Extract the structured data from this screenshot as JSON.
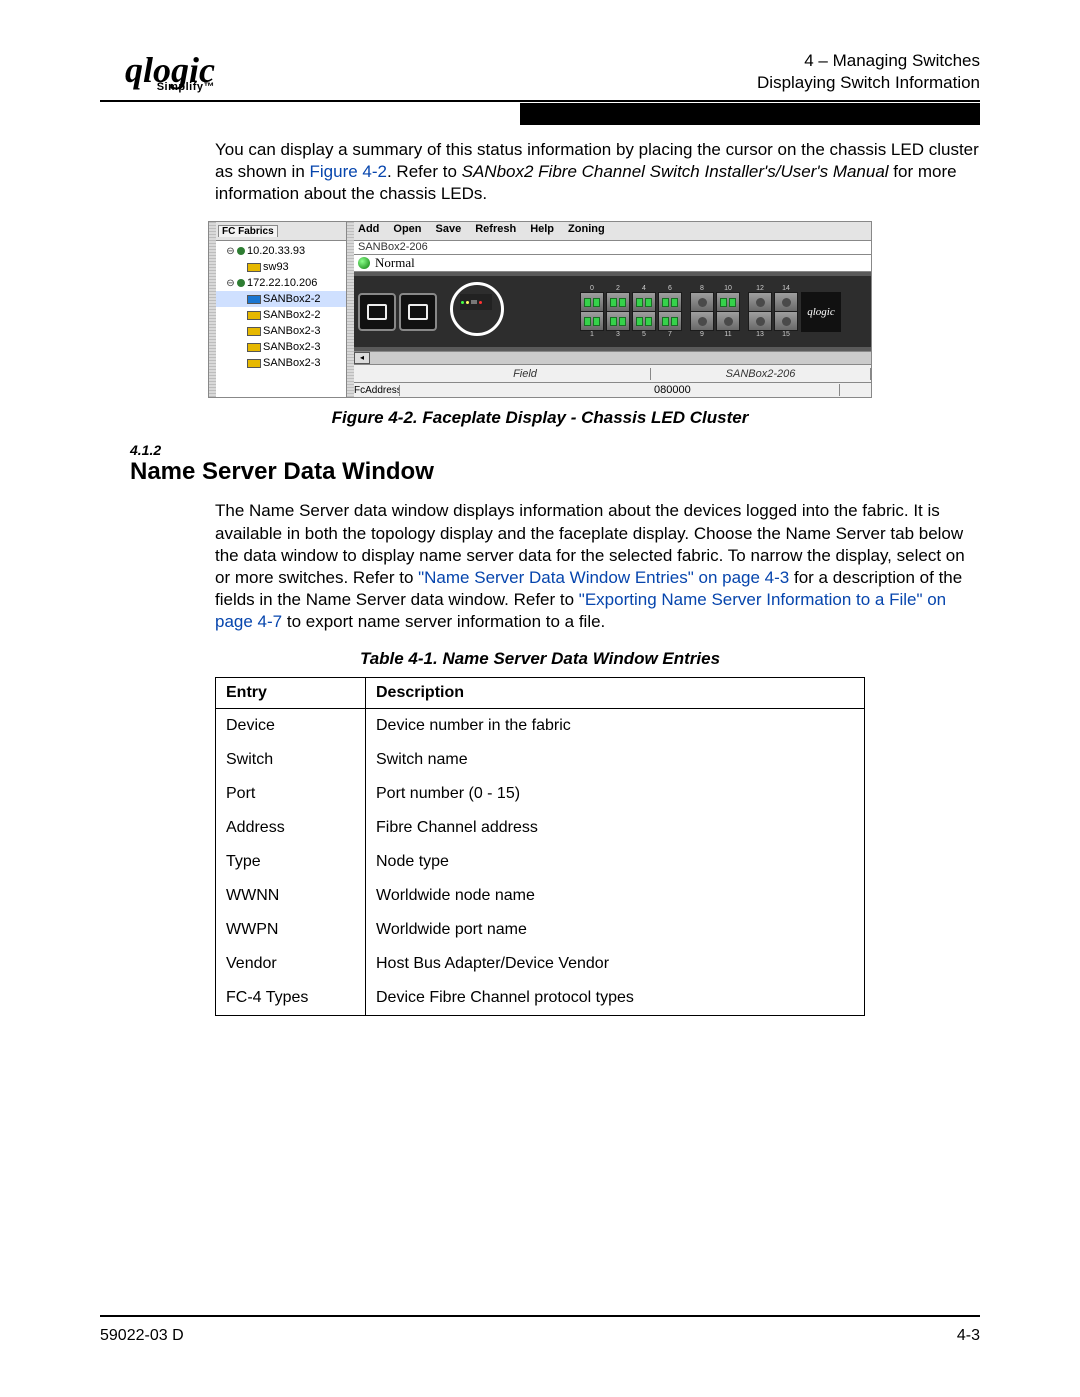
{
  "header": {
    "logo_main": "qlogic",
    "logo_sub": "Simplify™",
    "line1": "4 – Managing Switches",
    "line2": "Displaying Switch Information"
  },
  "intro": {
    "text_before_link": "You can display a summary of this status information by placing the cursor on the chassis LED cluster as shown in ",
    "fig_link": "Figure 4-2",
    "text_after_link": ". Refer to ",
    "italic": "SANbox2 Fibre Channel Switch Installer's/User's Manual",
    "text_end": " for more information about the chassis LEDs."
  },
  "screenshot": {
    "toolbar": [
      "Add",
      "Open",
      "Save",
      "Refresh",
      "Help",
      "Zoning"
    ],
    "tab_label": "FC Fabrics",
    "tree": [
      {
        "indent": 1,
        "exp": "⊖",
        "type": "dot",
        "label": "10.20.33.93"
      },
      {
        "indent": 2,
        "exp": "",
        "type": "sw",
        "label": "sw93"
      },
      {
        "indent": 1,
        "exp": "⊖",
        "type": "dot",
        "label": "172.22.10.206"
      },
      {
        "indent": 2,
        "exp": "",
        "type": "swb",
        "label": "SANBox2-2",
        "sel": true
      },
      {
        "indent": 2,
        "exp": "",
        "type": "sw",
        "label": "SANBox2-2"
      },
      {
        "indent": 2,
        "exp": "",
        "type": "sw",
        "label": "SANBox2-3"
      },
      {
        "indent": 2,
        "exp": "",
        "type": "sw",
        "label": "SANBox2-3"
      },
      {
        "indent": 2,
        "exp": "",
        "type": "sw",
        "label": "SANBox2-3"
      }
    ],
    "device_title": "SANBox2-206",
    "status": "Normal",
    "port_top": [
      "0",
      "2",
      "4",
      "6",
      "8",
      "10",
      "12",
      "14"
    ],
    "port_bot": [
      "1",
      "3",
      "5",
      "7",
      "9",
      "11",
      "13",
      "15"
    ],
    "brand": "qlogic",
    "grid_addr": "FcAddress",
    "grid_field": "Field",
    "grid_val": "080000",
    "grid_head2": "SANBox2-206"
  },
  "figure_caption": "Figure 4-2.  Faceplate Display - Chassis LED Cluster",
  "section_num": "4.1.2",
  "section_head": "Name Server Data Window",
  "para2": {
    "t1": "The Name Server data window displays information about the devices logged into the fabric. It is available in both the topology display and the faceplate display. Choose the Name Server tab below the data window to display name server data for the selected fabric. To narrow the display, select on or more switches. Refer to ",
    "link1": "\"Name Server Data Window Entries\" on page 4-3",
    "t2": " for a  description of the fields in the Name Server data window. Refer to ",
    "link2": "\"Exporting Name Server Information to a File\" on page 4-7",
    "t3": " to export name server information to a file."
  },
  "table_caption": "Table 4-1. Name Server Data Window Entries",
  "table": {
    "col1": "Entry",
    "col2": "Description",
    "rows": [
      {
        "e": "Device",
        "d": "Device number in the fabric"
      },
      {
        "e": "Switch",
        "d": "Switch name"
      },
      {
        "e": "Port",
        "d": "Port number (0 - 15)"
      },
      {
        "e": "Address",
        "d": "Fibre Channel address"
      },
      {
        "e": "Type",
        "d": "Node type"
      },
      {
        "e": "WWNN",
        "d": "Worldwide node name"
      },
      {
        "e": "WWPN",
        "d": "Worldwide port name"
      },
      {
        "e": "Vendor",
        "d": "Host Bus Adapter/Device Vendor"
      },
      {
        "e": "FC-4 Types",
        "d": "Device Fibre Channel protocol types"
      }
    ]
  },
  "footer": {
    "left": "59022-03  D",
    "right": "4-3"
  }
}
